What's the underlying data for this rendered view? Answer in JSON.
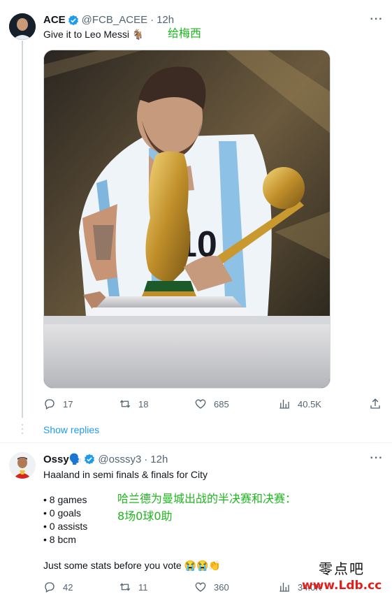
{
  "tweet1": {
    "name": "ACE",
    "handle": "@FCB_ACEE",
    "time": "12h",
    "text": "Give it to Leo Messi 🐐",
    "annotation": "给梅西",
    "actions": {
      "replies": "17",
      "retweets": "18",
      "likes": "685",
      "views": "40.5K"
    }
  },
  "show_replies": "Show replies",
  "tweet2": {
    "name": "Ossy🗣️",
    "handle": "@osssy3",
    "time": "12h",
    "text": "Haaland in semi finals & finals for City",
    "stats": [
      "• 8 games",
      "• 0 goals",
      "• 0 assists",
      "• 8 bcm"
    ],
    "annotation_line1": "哈兰德为曼城出战的半决赛和决赛：",
    "annotation_line2": "8场0球0助",
    "footer": "Just some stats before you vote 😭😭👏",
    "actions": {
      "replies": "42",
      "retweets": "11",
      "likes": "360",
      "views": "34.0K"
    }
  },
  "watermark": {
    "line1": "零点吧",
    "line2": "www.Ldb.cc"
  },
  "separator_dot": "·",
  "colors": {
    "accent": "#1d9bf0",
    "annotation": "#1fb61f",
    "secondary_text": "#536471"
  }
}
